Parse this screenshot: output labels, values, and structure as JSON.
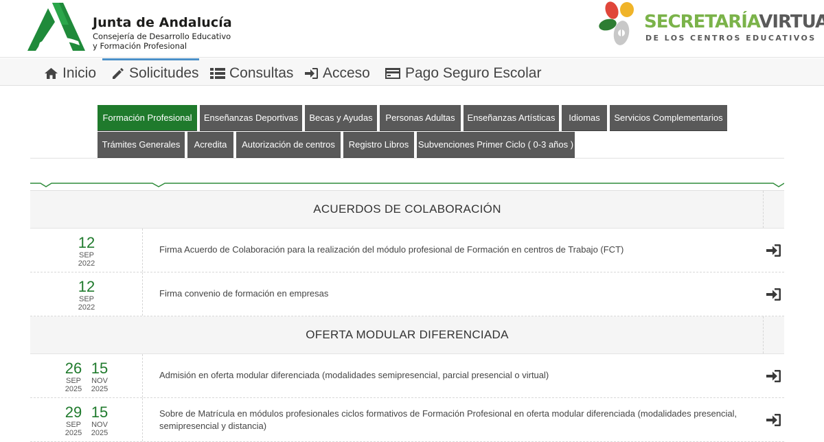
{
  "header": {
    "org_title": "Junta de Andalucía",
    "org_sub_line1": "Consejería de Desarrollo Educativo",
    "org_sub_line2": "y Formación Profesional",
    "sv_title_a": "SECRETARÍA",
    "sv_title_b": "VIRTUAL",
    "sv_sub": "DE LOS CENTROS EDUCATIVOS"
  },
  "nav": {
    "items": [
      {
        "label": "Inicio",
        "icon": "home-icon"
      },
      {
        "label": "Solicitudes",
        "icon": "pencil-icon"
      },
      {
        "label": "Consultas",
        "icon": "list-icon"
      },
      {
        "label": "Acceso",
        "icon": "sign-in-icon"
      },
      {
        "label": "Pago Seguro Escolar",
        "icon": "credit-card-icon"
      }
    ],
    "active": "Solicitudes"
  },
  "categories": {
    "row1": [
      "Formación Profesional",
      "Enseñanzas Deportivas",
      "Becas y Ayudas",
      "Personas Adultas",
      "Enseñanzas Artísticas",
      "Idiomas",
      "Servicios Complementarios"
    ],
    "row2": [
      "Trámites Generales",
      "Acredita",
      "Autorización de centros",
      "Registro Libros",
      "Subvenciones Primer Ciclo ( 0-3 años )"
    ],
    "active": "Formación Profesional"
  },
  "sections": [
    {
      "title": "ACUERDOS DE COLABORACIÓN",
      "rows": [
        {
          "start": {
            "day": "12",
            "month": "SEP",
            "year": "2022"
          },
          "text": "Firma Acuerdo de Colaboración para la realización del módulo profesional de Formación en centros de Trabajo (FCT)"
        },
        {
          "start": {
            "day": "12",
            "month": "SEP",
            "year": "2022"
          },
          "text": "Firma convenio de formación en empresas"
        }
      ]
    },
    {
      "title": "OFERTA MODULAR DIFERENCIADA",
      "rows": [
        {
          "start": {
            "day": "26",
            "month": "SEP",
            "year": "2025"
          },
          "end": {
            "day": "15",
            "month": "NOV",
            "year": "2025"
          },
          "text": "Admisión en oferta modular diferenciada (modalidades semipresencial, parcial presencial o virtual)"
        },
        {
          "start": {
            "day": "29",
            "month": "SEP",
            "year": "2025"
          },
          "end": {
            "day": "15",
            "month": "NOV",
            "year": "2025"
          },
          "text": "Sobre de Matrícula en módulos profesionales ciclos formativos de Formación Profesional en oferta modular diferenciada (modalidades presencial, semipresencial y distancia)"
        }
      ]
    }
  ],
  "colors": {
    "green": "#1f7a2c",
    "button_gray": "#595959",
    "accent_blue": "#4a90c8"
  }
}
